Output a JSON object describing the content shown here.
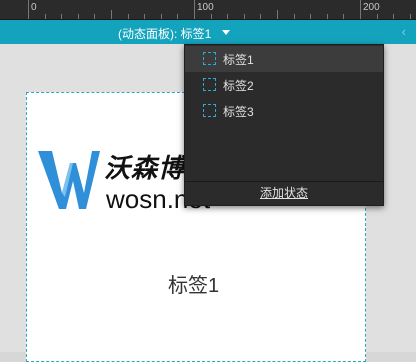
{
  "ruler": {
    "labels": [
      "0",
      "100",
      "200"
    ]
  },
  "toolbar": {
    "title": "(动态面板): 标签1"
  },
  "canvas": {
    "panel_label": "标签1"
  },
  "logo": {
    "cn": "沃森博客",
    "en": "wosn.net"
  },
  "dropdown": {
    "items": [
      {
        "label": "标签1"
      },
      {
        "label": "标签2"
      },
      {
        "label": "标签3"
      }
    ],
    "add_label": "添加状态"
  }
}
